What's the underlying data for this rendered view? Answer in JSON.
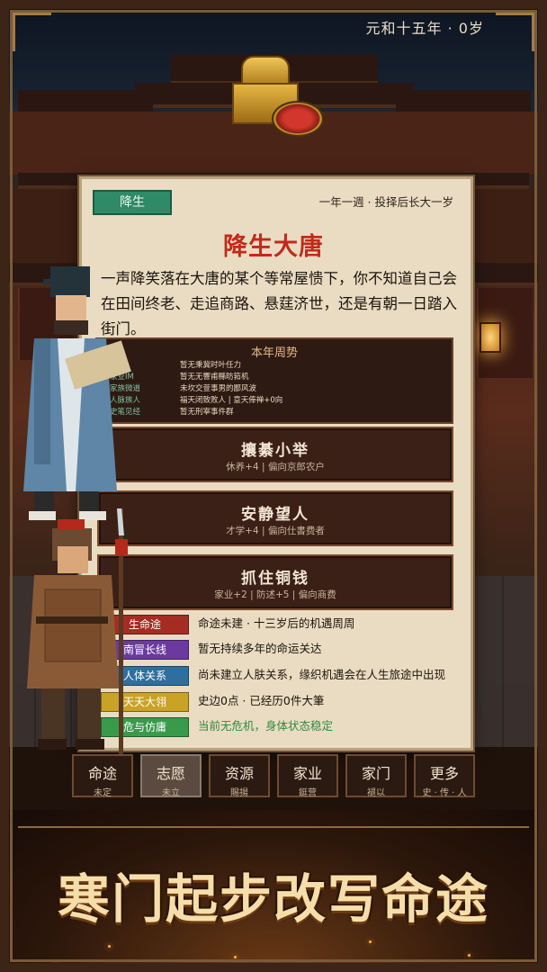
{
  "header": {
    "date": "元和十五年 · 0岁"
  },
  "panel": {
    "tag": "降生",
    "hint": "一年一週 · 投择后长大一岁",
    "title": "降生大唐",
    "story": "一声降笑落在大唐的某个等常屋愦下，你不知道自己会在田间终老、走追商路、悬莛济世，还是有朝一日踏入街门。",
    "year_title": "本年周势",
    "year_rows": [
      {
        "k": "命途",
        "v": "暂无秉冀时叶任力"
      },
      {
        "k": "家业IM",
        "v": "暂无无響甫縣昉筘机"
      },
      {
        "k": "家族微道",
        "v": "未坎交萱事男的鄙风波"
      },
      {
        "k": "人脉族人",
        "v": "福天闭致败人 | 意天俸禅+0向"
      },
      {
        "k": "史笔见经",
        "v": "暂无刑宰事件群"
      }
    ]
  },
  "choices": [
    {
      "title": "攘綦小举",
      "desc": "休养+4 | 偏向京郎农户"
    },
    {
      "title": "安静望人",
      "desc": "才学+4 | 偏向仕書费者"
    },
    {
      "title": "抓住铜钱",
      "desc": "家业+2 | 防述+5 | 偏向商费"
    }
  ],
  "stats": [
    {
      "label": "生命途",
      "text": "命途未建 · 十三岁后的机遇周周",
      "color": "#a52c22"
    },
    {
      "label": "南冒长线",
      "text": "暂无持续多年的命运关达",
      "color": "#6b3aa0"
    },
    {
      "label": "人体关系",
      "text": "尚未建立人肤关系，缘织机遇会在人生旅途中出现",
      "color": "#2f6f9e"
    },
    {
      "label": "天天大翎",
      "text": "史边0点 · 已经历0件大筆",
      "color": "#c9a227"
    },
    {
      "label": "危与仿庸",
      "text": "当前无危机，身体状态稳定",
      "color": "#3a9a4c",
      "text_color": "#2f8a3e"
    }
  ],
  "tabs": [
    {
      "label": "命途",
      "sub": "未定"
    },
    {
      "label": "志愿",
      "sub": "未立"
    },
    {
      "label": "资源",
      "sub": "賜揚"
    },
    {
      "label": "家业",
      "sub": "鋌营"
    },
    {
      "label": "家门",
      "sub": "褪以"
    },
    {
      "label": "更多",
      "sub": "史 · 传 · 人"
    }
  ],
  "active_tab": 1,
  "banner": {
    "slogan": "寒门起步改写命途"
  }
}
